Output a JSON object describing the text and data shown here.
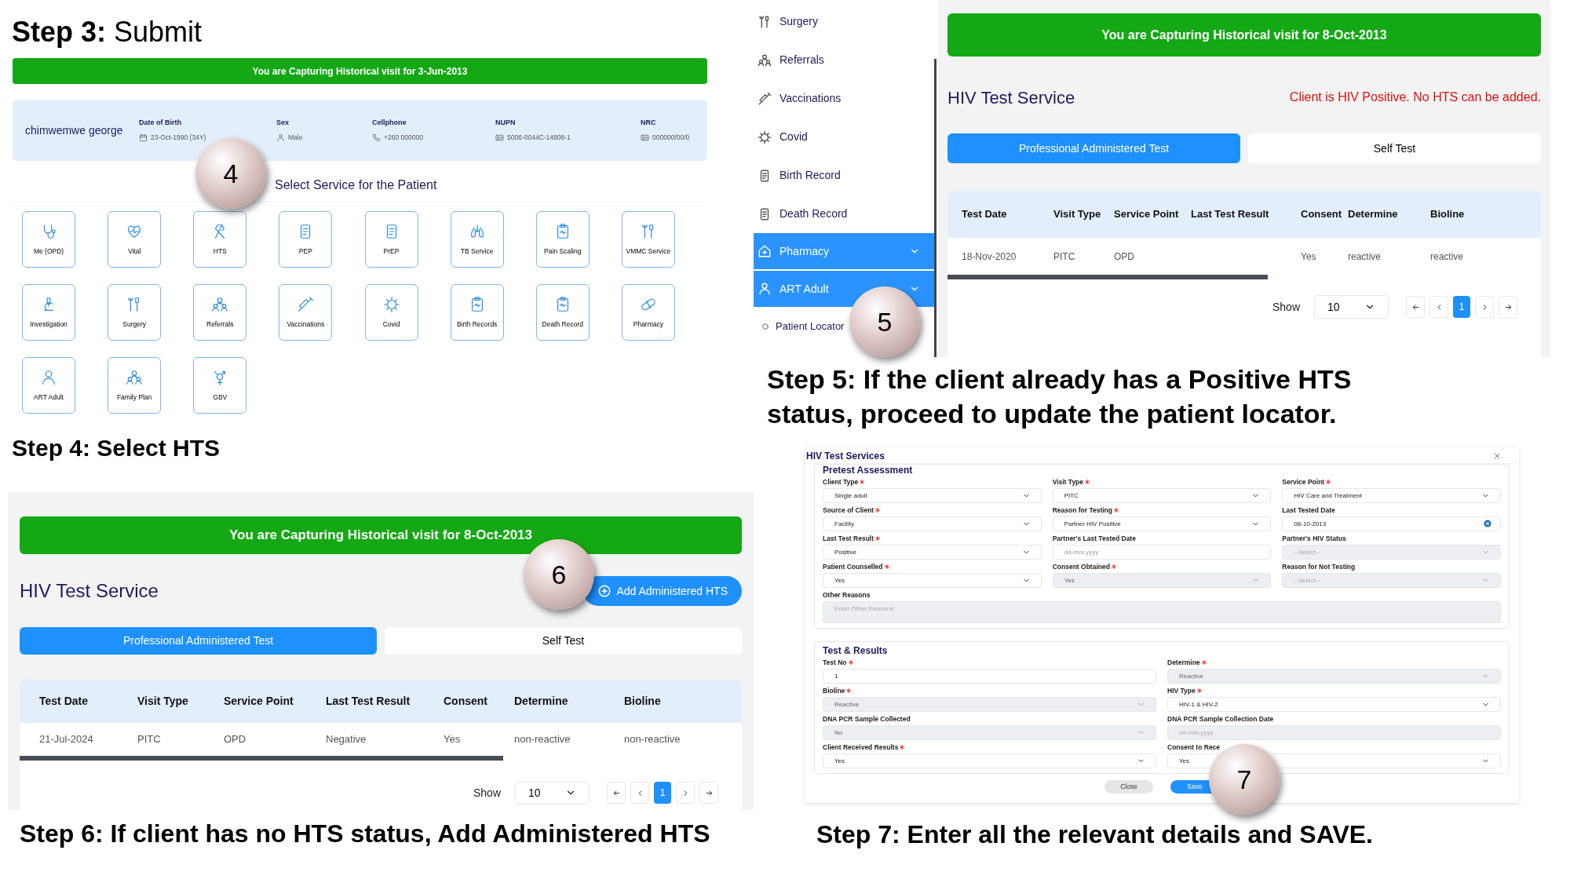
{
  "step3_heading": "**Step 3:** Submit",
  "service_screen": {
    "banner": "You are Capturing Historical visit for 3-Jun-2013",
    "patient": {
      "name": "chimwemwe george",
      "fields": [
        {
          "label": "Date of Birth",
          "value": "23-Oct-1990 (34Y)",
          "kind": "calendar"
        },
        {
          "label": "Sex",
          "value": "Male",
          "kind": "person"
        },
        {
          "label": "Cellphone",
          "value": "+260 000000",
          "kind": "phone"
        },
        {
          "label": "NUPN",
          "value": "5006-0044C-14808-1",
          "kind": "id"
        },
        {
          "label": "NRC",
          "value": "000000/00/0",
          "kind": "id"
        }
      ]
    },
    "section_title": "Select Service for the Patient",
    "services": [
      {
        "label": "Me (OPD)",
        "kind": "stethoscope"
      },
      {
        "label": "Vital",
        "kind": "heart"
      },
      {
        "label": "HTS",
        "kind": "ribbon"
      },
      {
        "label": "PEP",
        "kind": "document"
      },
      {
        "label": "PrEP",
        "kind": "document"
      },
      {
        "label": "TB Service",
        "kind": "lungs"
      },
      {
        "label": "Pain Scaling",
        "kind": "clipboard"
      },
      {
        "label": "VMMC Service",
        "kind": "tools"
      },
      {
        "label": "Investigation",
        "kind": "microscope"
      },
      {
        "label": "Surgery",
        "kind": "tools"
      },
      {
        "label": "Referrals",
        "kind": "people"
      },
      {
        "label": "Vaccinations",
        "kind": "syringe"
      },
      {
        "label": "Covid",
        "kind": "virus"
      },
      {
        "label": "Birth Records",
        "kind": "clipboard"
      },
      {
        "label": "Death Record",
        "kind": "clipboard"
      },
      {
        "label": "Pharmacy",
        "kind": "pill"
      },
      {
        "label": "ART Adult",
        "kind": "person"
      },
      {
        "label": "Family Plan",
        "kind": "people"
      },
      {
        "label": "GBV",
        "kind": "gender"
      }
    ],
    "step_badge": "4"
  },
  "step4_caption": "Step 4: Select HTS",
  "positive_screen": {
    "sidebar": [
      {
        "label": "Surgery",
        "kind": "tools",
        "selected": false,
        "expandable": false
      },
      {
        "label": "Referrals",
        "kind": "people",
        "selected": false,
        "expandable": false
      },
      {
        "label": "Vaccinations",
        "kind": "syringe",
        "selected": false,
        "expandable": false
      },
      {
        "label": "Covid",
        "kind": "virus",
        "selected": false,
        "expandable": false
      },
      {
        "label": "Birth Record",
        "kind": "document",
        "selected": false,
        "expandable": false
      },
      {
        "label": "Death Record",
        "kind": "document",
        "selected": false,
        "expandable": false
      },
      {
        "label": "Pharmacy",
        "kind": "house",
        "selected": true,
        "expandable": true
      },
      {
        "label": "ART Adult",
        "kind": "person",
        "selected": true,
        "expandable": true,
        "children": [
          {
            "label": "Patient Locator"
          }
        ]
      }
    ],
    "banner": "You are Capturing Historical visit for 8-Oct-2013",
    "title": "HIV Test Service",
    "alert": "Client is HIV Positive. No HTS can be added.",
    "tabs": [
      {
        "label": "Professional Administered Test",
        "selected": true
      },
      {
        "label": "Self Test",
        "selected": false
      }
    ],
    "table": {
      "columns": [
        "Test Date",
        "Visit Type",
        "Service Point",
        "Last Test Result",
        "Consent",
        "Determine",
        "Bioline"
      ],
      "rows": [
        {
          "cells": [
            "18-Nov-2020",
            "PITC",
            "OPD",
            null,
            "Yes",
            "reactive",
            "reactive"
          ]
        }
      ]
    },
    "pagination": {
      "show_label": "Show",
      "page_size": "10",
      "pages": [
        {
          "label": "1",
          "selected": true
        }
      ]
    },
    "step_badge": "5"
  },
  "step5_caption": "Step 5: If the client already has a Positive HTS status, proceed to update the patient locator.",
  "hts_screen": {
    "banner": "You are Capturing Historical visit for 8-Oct-2013",
    "title": "HIV Test Service",
    "add_button": "Add Administered HTS",
    "tabs": [
      {
        "label": "Professional Administered Test",
        "selected": true
      },
      {
        "label": "Self Test",
        "selected": false
      }
    ],
    "table": {
      "columns": [
        "Test Date",
        "Visit Type",
        "Service Point",
        "Last Test Result",
        "Consent",
        "Determine",
        "Bioline"
      ],
      "rows": [
        {
          "cells": [
            "21-Jul-2024",
            "PITC",
            "OPD",
            "Negative",
            "Yes",
            "non-reactive",
            "non-reactive"
          ]
        }
      ]
    },
    "pagination": {
      "show_label": "Show",
      "page_size": "10",
      "pages": [
        {
          "label": "1",
          "selected": true
        }
      ]
    },
    "step_badge": "6"
  },
  "step6_caption": "Step 6: If client has no HTS status, Add Administered HTS",
  "modal": {
    "title": "HIV Test Services",
    "sections": [
      {
        "title": "Pretest Assessment",
        "fields": [
          {
            "label": "Client Type",
            "required": true,
            "kind": "select",
            "value": "Single adult",
            "disabled": false
          },
          {
            "label": "Visit Type",
            "required": true,
            "kind": "select",
            "value": "PITC",
            "disabled": false
          },
          {
            "label": "Service Point",
            "required": true,
            "kind": "select",
            "value": "HIV Care and Treatment",
            "disabled": false
          },
          {
            "label": "Source of Client",
            "required": true,
            "kind": "select",
            "value": "Facility",
            "disabled": false
          },
          {
            "label": "Reason for Testing",
            "required": true,
            "kind": "select",
            "value": "Partner HIV Positive",
            "disabled": false
          },
          {
            "label": "Last Tested Date",
            "required": false,
            "kind": "date",
            "value": "08-10-2013",
            "clearable": true,
            "disabled": false
          },
          {
            "label": "Last Test Result",
            "required": true,
            "kind": "select",
            "value": "Positive",
            "disabled": false
          },
          {
            "label": "Partner's Last Tested Date",
            "required": false,
            "kind": "date",
            "placeholder": "dd-mm-yyyy",
            "disabled": false
          },
          {
            "label": "Partner's HIV Status",
            "required": false,
            "kind": "select",
            "placeholder": "--Select--",
            "disabled": true
          },
          {
            "label": "Patient Counselled",
            "required": true,
            "kind": "select",
            "value": "Yes",
            "disabled": false
          },
          {
            "label": "Consent Obtained",
            "required": true,
            "kind": "select",
            "value": "Yes",
            "disabled": true
          },
          {
            "label": "Reason for Not Testing",
            "required": false,
            "kind": "select",
            "placeholder": "--Select--",
            "disabled": true
          },
          {
            "label": "Other Reasons",
            "required": false,
            "kind": "textarea",
            "placeholder": "Enter Other Reasons",
            "disabled": true
          }
        ]
      },
      {
        "title": "Test & Results",
        "fields": [
          {
            "label": "Test No",
            "required": true,
            "kind": "text",
            "value": "1",
            "disabled": false
          },
          {
            "label": "Determine",
            "required": true,
            "kind": "select",
            "value": "Reactive",
            "disabled": true
          },
          {
            "label": "Bioline",
            "required": true,
            "kind": "select",
            "value": "Reactive",
            "disabled": true
          },
          {
            "label": "HIV Type",
            "required": true,
            "kind": "select",
            "value": "HIV-1 & HIV-2",
            "disabled": false
          },
          {
            "label": "DNA PCR Sample Collected",
            "required": false,
            "kind": "select",
            "value": "No",
            "disabled": true
          },
          {
            "label": "DNA PCR Sample Collection Date",
            "required": false,
            "kind": "date",
            "placeholder": "dd-mm-yyyy",
            "disabled": true
          },
          {
            "label": "Client Received Results",
            "required": true,
            "kind": "select",
            "value": "Yes",
            "disabled": false
          },
          {
            "label": "Consent to Rece",
            "required": false,
            "kind": "select",
            "value": "Yes",
            "disabled": false
          }
        ]
      }
    ],
    "buttons": [
      {
        "label": "Close",
        "kind": "secondary"
      },
      {
        "label": "Save",
        "kind": "primary"
      }
    ],
    "step_badge": "7"
  },
  "step7_caption": "Step 7: Enter all the relevant details and SAVE."
}
